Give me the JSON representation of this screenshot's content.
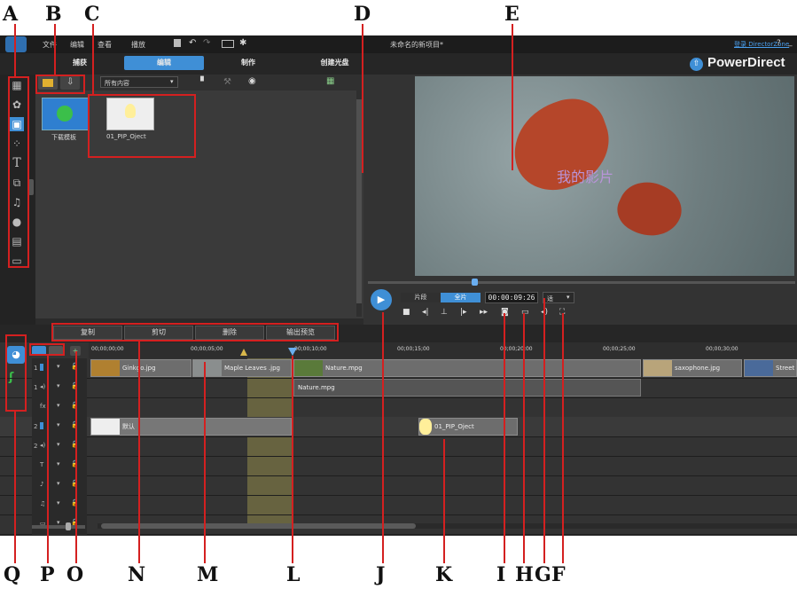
{
  "callouts": {
    "A": "A",
    "B": "B",
    "C": "C",
    "D": "D",
    "E": "E",
    "F": "F",
    "G": "G",
    "H": "H",
    "I": "I",
    "J": "J",
    "K": "K",
    "L": "L",
    "M": "M",
    "N": "N",
    "O": "O",
    "P": "P",
    "Q": "Q"
  },
  "app": {
    "brand": "PowerDirect",
    "menu": [
      "文件",
      "编辑",
      "查看",
      "播放"
    ],
    "project_title": "未命名的新项目*",
    "login_link": "登录 DirectorZone",
    "window_controls": [
      "?",
      "_"
    ],
    "tabs": [
      "捕获",
      "编辑",
      "制作",
      "创建光盘"
    ],
    "active_tab_index": 1
  },
  "library": {
    "filter": "所有内容",
    "items": [
      {
        "label": "下载模板",
        "icon": "globe-icon"
      },
      {
        "label": "01_PIP_Oject",
        "icon": "lightbulb-icon"
      }
    ]
  },
  "player": {
    "preview_caption": "我的影片",
    "mode_clip": "片段",
    "mode_movie": "全片",
    "timecode": "00:00:09:26",
    "quality": "适"
  },
  "edit_buttons": [
    "复制",
    "剪切",
    "删除",
    "输出预览"
  ],
  "timeline": {
    "ruler": [
      "00;00;00;00",
      "00;00;05;00",
      "00;00;10;00",
      "00;00;15;00",
      "00;00;20;00",
      "00;00;25;00",
      "00;00;30;00"
    ],
    "track_numbers": [
      "1",
      "1",
      "",
      "2",
      "2",
      "",
      "",
      "",
      ""
    ],
    "clips": {
      "ginkgo": "Ginkgo.jpg",
      "maple": "Maple Leaves .jpg",
      "nature": "Nature.mpg",
      "nature_audio": "Nature.mpg",
      "saxophone": "saxophone.jpg",
      "street": "Street",
      "title_clip": "默认",
      "pip": "01_PIP_Oject"
    }
  },
  "colors": {
    "accent": "#3f8fd6",
    "callout_red": "#d42020",
    "app_bg": "#2b2b2b"
  }
}
